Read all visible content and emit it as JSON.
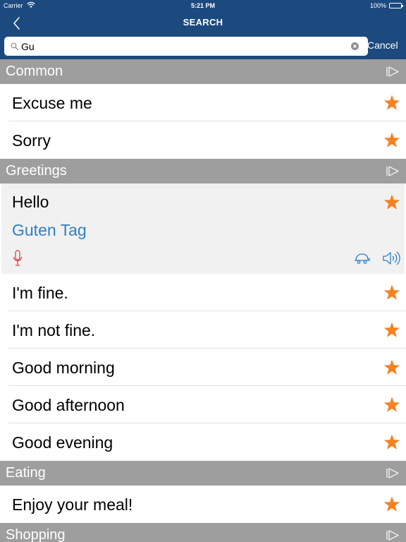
{
  "status_bar": {
    "carrier": "Carrier",
    "time": "5:21 PM",
    "battery": "100%"
  },
  "nav": {
    "title": "SEARCH",
    "back_icon": "chevron-left-icon"
  },
  "search": {
    "value": "Gu",
    "cancel_label": "Cancel"
  },
  "sections": [
    {
      "title": "Common",
      "items": [
        {
          "label": "Excuse me"
        },
        {
          "label": "Sorry"
        }
      ]
    },
    {
      "title": "Greetings",
      "expanded": {
        "label": "Hello",
        "translation": "Guten Tag"
      },
      "items": [
        {
          "label": "I'm fine."
        },
        {
          "label": "I'm not fine."
        },
        {
          "label": "Good morning"
        },
        {
          "label": "Good afternoon"
        },
        {
          "label": "Good evening"
        }
      ]
    },
    {
      "title": "Eating",
      "items": [
        {
          "label": "Enjoy your meal!"
        }
      ]
    },
    {
      "title": "Shopping",
      "items": []
    }
  ],
  "colors": {
    "nav_bg": "#1c4a7e",
    "section_bg": "#9e9e9e",
    "star": "#f58220",
    "translation": "#2f80c4",
    "mic": "#e0323c"
  }
}
